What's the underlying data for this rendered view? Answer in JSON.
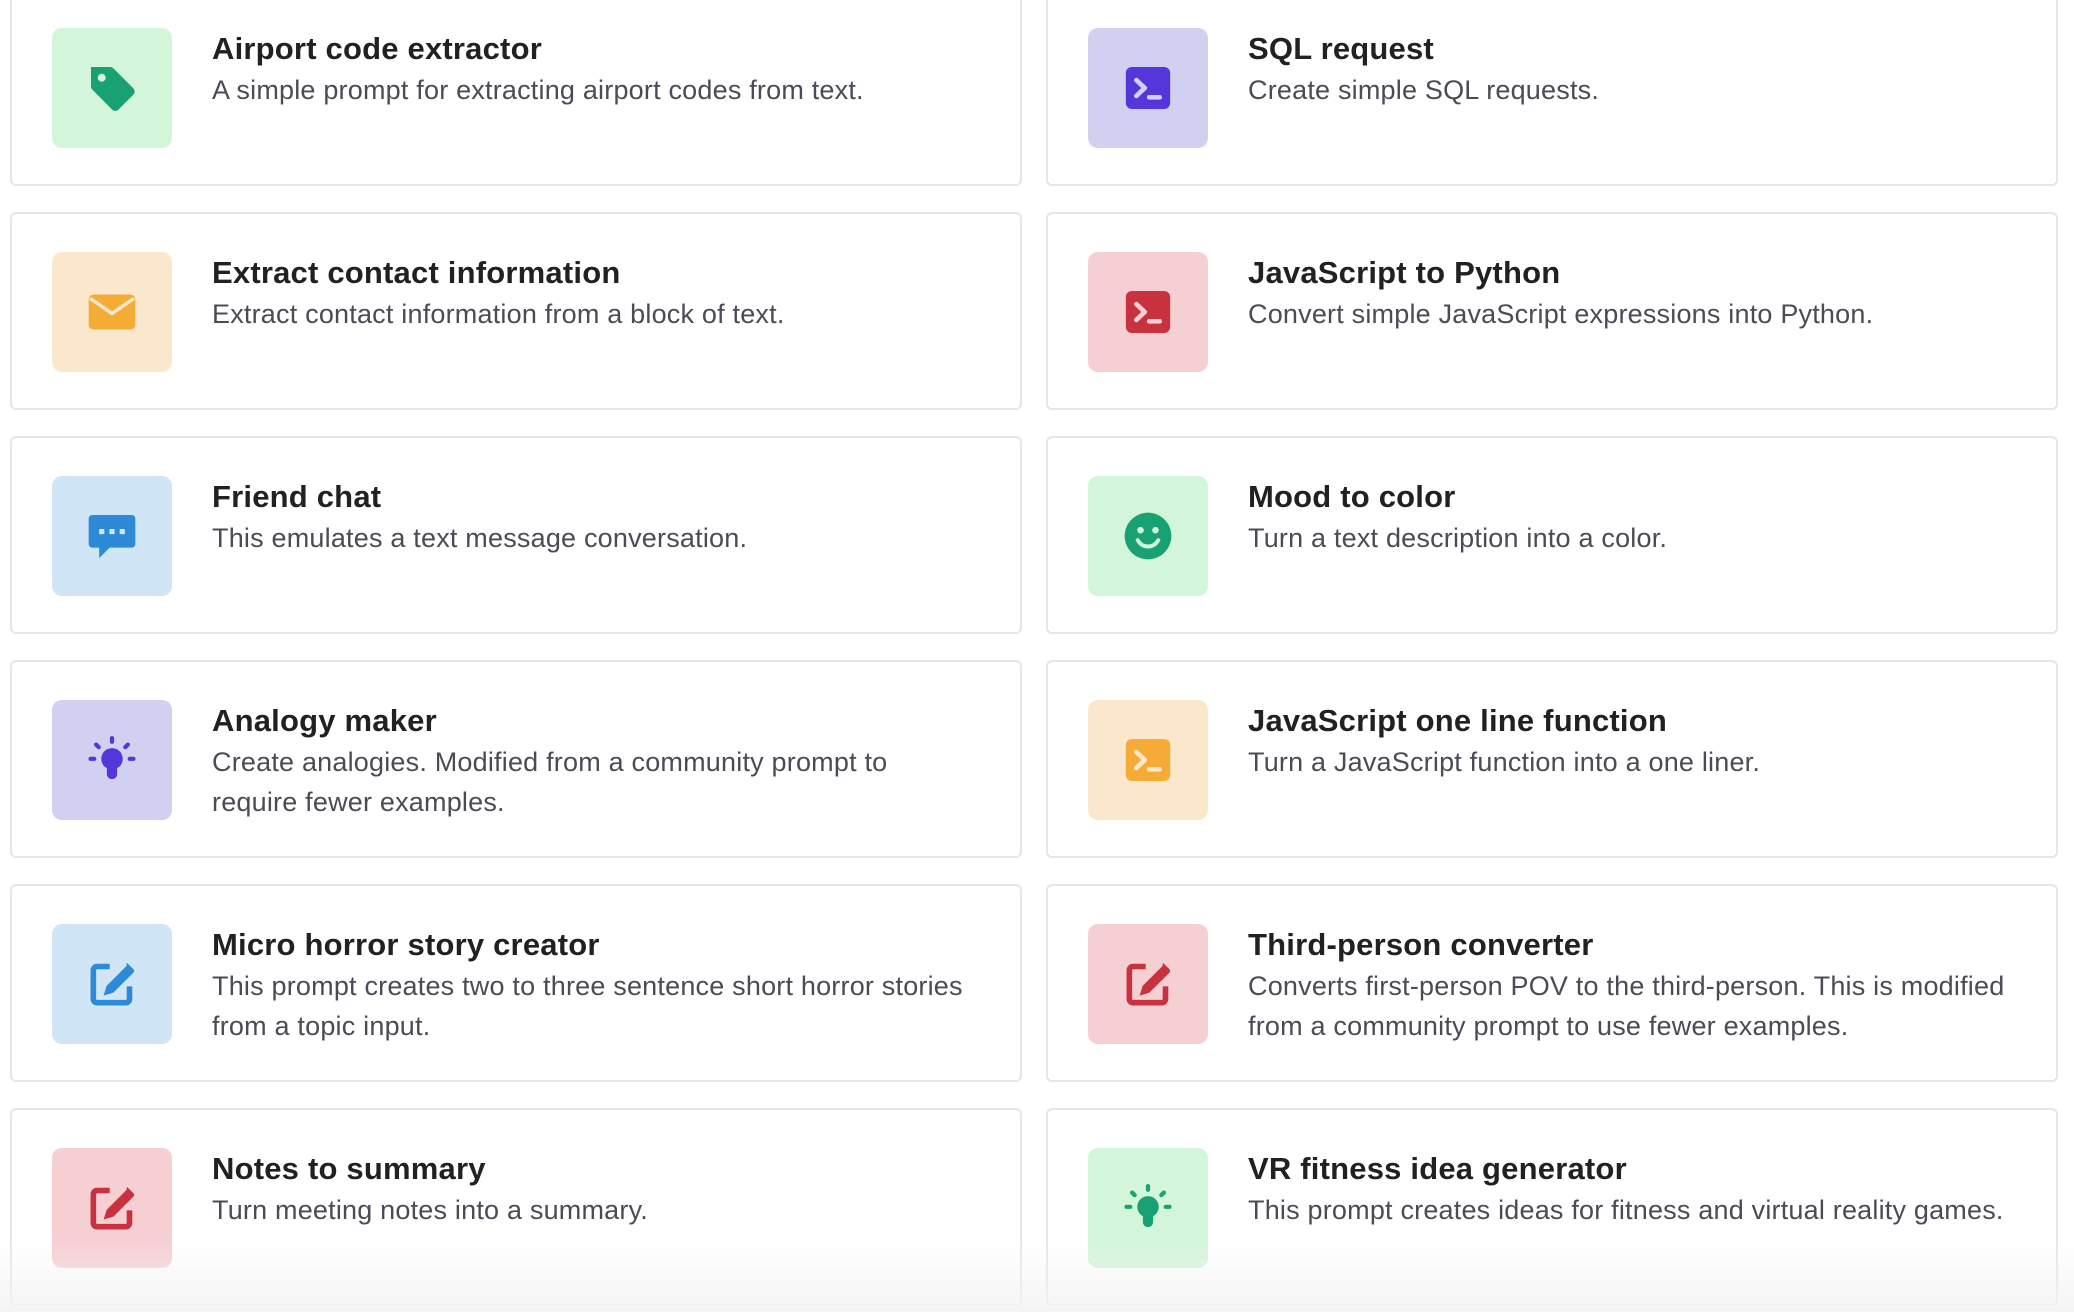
{
  "colors": {
    "green": "#19a174",
    "purple": "#5436da",
    "orange": "#f4ac36",
    "red": "#c8323f",
    "blue": "#2d8ad6"
  },
  "examples": [
    {
      "title": "Airport code extractor",
      "description": "A simple prompt for extracting airport codes from text.",
      "icon": "tag-icon",
      "color": "green"
    },
    {
      "title": "SQL request",
      "description": "Create simple SQL requests.",
      "icon": "terminal-icon",
      "color": "purple"
    },
    {
      "title": "Extract contact information",
      "description": "Extract contact information from a block of text.",
      "icon": "envelope-icon",
      "color": "orange"
    },
    {
      "title": "JavaScript to Python",
      "description": "Convert simple JavaScript expressions into Python.",
      "icon": "terminal-icon",
      "color": "red"
    },
    {
      "title": "Friend chat",
      "description": "This emulates a text message conversation.",
      "icon": "chat-bubble-icon",
      "color": "blue"
    },
    {
      "title": "Mood to color",
      "description": "Turn a text description into a color.",
      "icon": "smiley-icon",
      "color": "green"
    },
    {
      "title": "Analogy maker",
      "description": "Create analogies. Modified from a community prompt to require fewer examples.",
      "icon": "lightbulb-icon",
      "color": "purple"
    },
    {
      "title": "JavaScript one line function",
      "description": "Turn a JavaScript function into a one liner.",
      "icon": "terminal-icon",
      "color": "orange"
    },
    {
      "title": "Micro horror story creator",
      "description": "This prompt creates two to three sentence short horror stories from a topic input.",
      "icon": "edit-icon",
      "color": "blue"
    },
    {
      "title": "Third-person converter",
      "description": "Converts first-person POV to the third-person. This is modified from a community prompt to use fewer examples.",
      "icon": "edit-icon",
      "color": "red"
    },
    {
      "title": "Notes to summary",
      "description": "Turn meeting notes into a summary.",
      "icon": "edit-icon",
      "color": "red"
    },
    {
      "title": "VR fitness idea generator",
      "description": "This prompt creates ideas for fitness and virtual reality games.",
      "icon": "lightbulb-icon",
      "color": "green"
    }
  ]
}
